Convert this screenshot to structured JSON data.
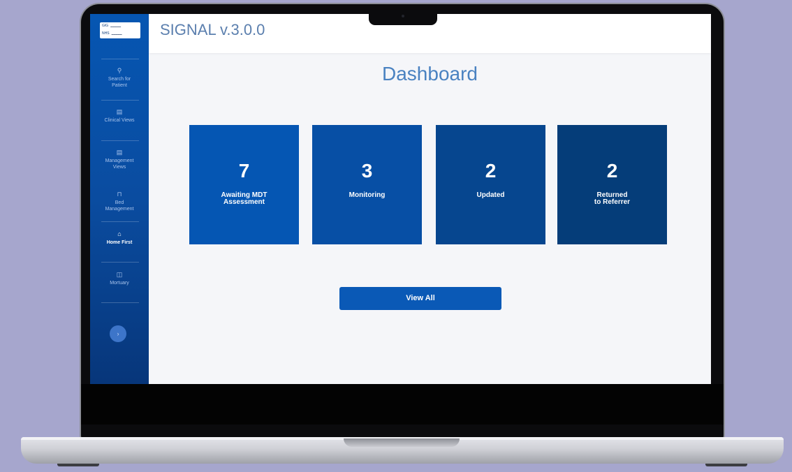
{
  "app": {
    "title": "SIGNAL v.3.0.0"
  },
  "logo": {
    "line1": "GIG",
    "line2": "NHS"
  },
  "sidebar": {
    "items": [
      {
        "label": "Search for\nPatient",
        "icon": "search-icon",
        "glyph": "⚲",
        "active": false
      },
      {
        "label": "Clinical Views",
        "icon": "list-icon",
        "glyph": "▤",
        "active": false
      },
      {
        "label": "Management\nViews",
        "icon": "list-icon",
        "glyph": "▤",
        "active": false
      },
      {
        "label": "Bed\nManagement",
        "icon": "bed-icon",
        "glyph": "⊓",
        "active": false
      },
      {
        "label": "Home First",
        "icon": "home-icon",
        "glyph": "⌂",
        "active": true
      },
      {
        "label": "Mortuary",
        "icon": "book-icon",
        "glyph": "◫",
        "active": false
      }
    ],
    "expand_glyph": "›"
  },
  "dashboard": {
    "title": "Dashboard",
    "cards": [
      {
        "count": "7",
        "label": "Awaiting MDT\nAssessment",
        "color": "#0556b3"
      },
      {
        "count": "3",
        "label": "Monitoring",
        "color": "#074fa5"
      },
      {
        "count": "2",
        "label": "Updated",
        "color": "#06468f"
      },
      {
        "count": "2",
        "label": "Returned\nto Referrer",
        "color": "#053d79"
      }
    ],
    "view_all_label": "View All"
  }
}
